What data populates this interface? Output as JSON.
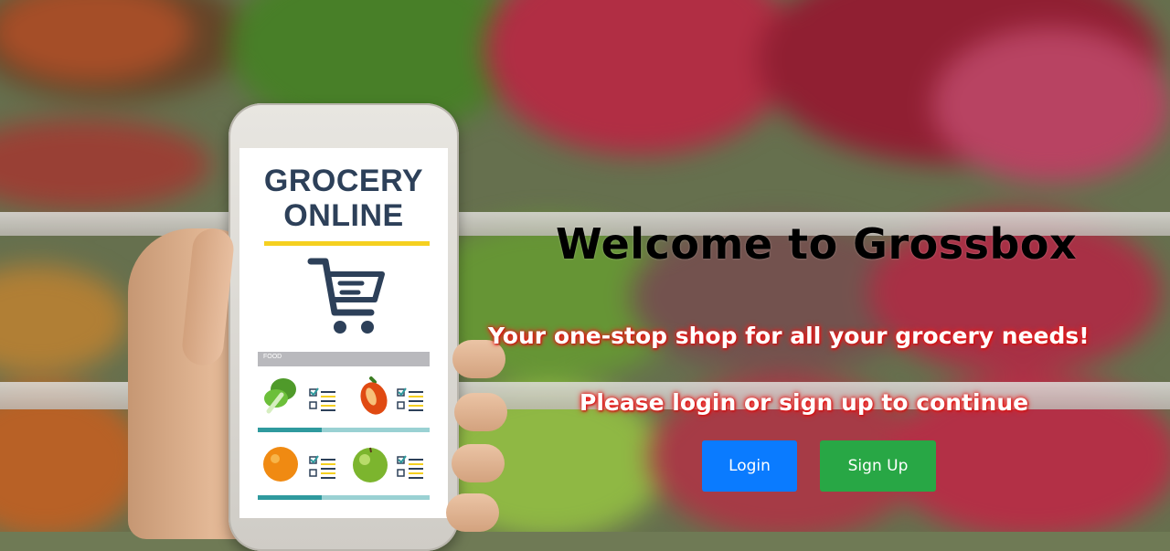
{
  "background": {
    "description_icon": "grocery-shelves-photo"
  },
  "phone_app": {
    "title_line1": "GROCERY",
    "title_line2": "ONLINE",
    "section_label": "FOOD",
    "icons": [
      "cart-icon",
      "lettuce-icon",
      "bell-pepper-icon",
      "orange-icon",
      "apple-icon",
      "checklist-icon"
    ],
    "colors": {
      "title": "#2d4059",
      "accent_bar": "#f5d020",
      "progress": "#2f9a9e"
    }
  },
  "hero": {
    "title": "Welcome to Grossbox",
    "tagline": "Your one-stop shop for all your grocery needs!",
    "prompt": "Please login or sign up to continue"
  },
  "actions": {
    "login_label": "Login",
    "signup_label": "Sign Up",
    "colors": {
      "login": "#0a7bff",
      "signup": "#28a745"
    }
  }
}
